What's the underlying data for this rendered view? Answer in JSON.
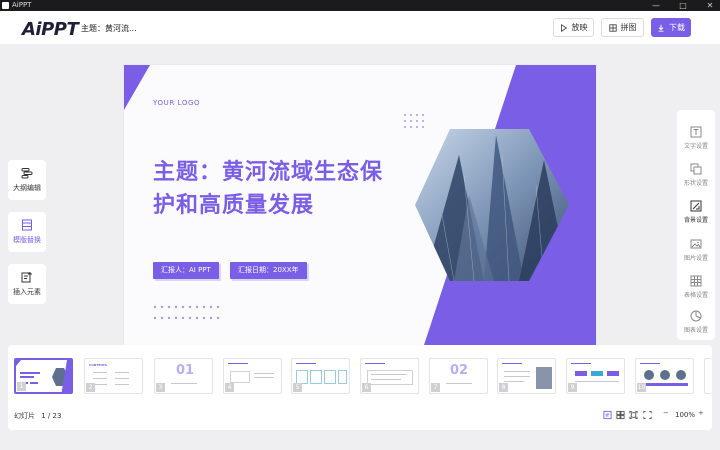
{
  "window": {
    "app_name": "AiPPT",
    "minimize": "—",
    "maximize": "□",
    "close": "✕"
  },
  "header": {
    "logo": "AiPPT",
    "doc_title": "主题：黄河流...",
    "play_label": "放映",
    "puzzle_label": "拼图",
    "download_label": "下载",
    "accent_color": "#7a5ee6"
  },
  "left_tools": [
    {
      "label": "大纲编辑",
      "icon": "outline-icon"
    },
    {
      "label": "模版替换",
      "icon": "template-icon"
    },
    {
      "label": "插入元素",
      "icon": "insert-icon"
    }
  ],
  "slide": {
    "logo_text": "YOUR LOGO",
    "title_line1": "主题：黄河流域生态保",
    "title_line2": "护和高质量发展",
    "reporter": "汇报人：AI PPT",
    "report_date": "汇报日期：20XX年"
  },
  "right_panel": [
    {
      "label": "文字设置",
      "icon": "text-icon"
    },
    {
      "label": "形状设置",
      "icon": "shape-icon"
    },
    {
      "label": "背景设置",
      "icon": "background-icon"
    },
    {
      "label": "图片设置",
      "icon": "image-icon"
    },
    {
      "label": "表格设置",
      "icon": "table-icon"
    },
    {
      "label": "图表设置",
      "icon": "chart-icon"
    }
  ],
  "thumbnails": [
    {
      "num": "1"
    },
    {
      "num": "2"
    },
    {
      "num": "3"
    },
    {
      "num": "4"
    },
    {
      "num": "5"
    },
    {
      "num": "6"
    },
    {
      "num": "7"
    },
    {
      "num": "8"
    },
    {
      "num": "9"
    },
    {
      "num": "10"
    }
  ],
  "thumb_content": {
    "s2_title": "CONTENTS",
    "s3_big": "01",
    "s7_big": "02"
  },
  "status": {
    "slide_label": "幻灯片",
    "slide_counter": "1 / 23",
    "zoom_minus": "−",
    "zoom_value": "100%",
    "zoom_plus": "+"
  }
}
